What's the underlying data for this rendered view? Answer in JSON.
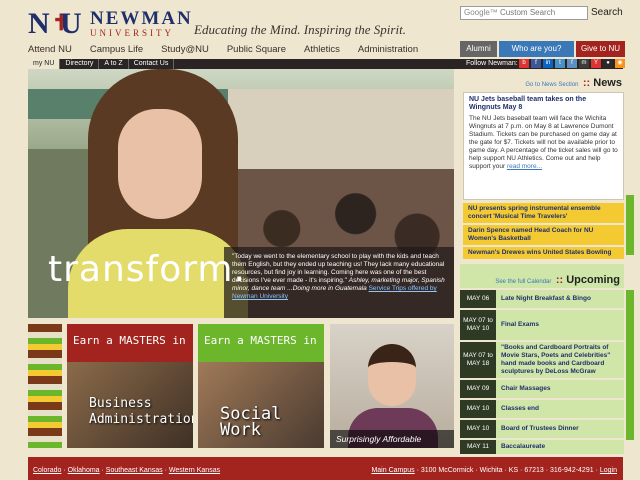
{
  "header": {
    "logo_name": "NEWMAN",
    "logo_university": "UNIVERSITY",
    "tagline": "Educating the Mind. Inspiring the Spirit.",
    "search_placeholder": "Custom Search",
    "search_button": "Search"
  },
  "nav": {
    "items": [
      "Attend NU",
      "Campus Life",
      "Study@NU",
      "Public Square",
      "Athletics",
      "Administration"
    ]
  },
  "tabs": {
    "alumni": "Alumni",
    "who": "Who are you?",
    "give": "Give to NU"
  },
  "subbar": {
    "items": [
      "my NU",
      "Directory",
      "A to Z",
      "Contact Us"
    ],
    "follow": "Follow Newman:"
  },
  "hero": {
    "headline": "transform.",
    "quote": "\"Today we went to the elementary school to play with the kids and teach them English, but they ended up teaching us! They lack many educational resources, but find joy in learning. Coming here was one of the best decisions I've ever made - it's inspiring.\"",
    "attribution": "Ashley, marketing major, Spanish minor, dance team ...Doing more in Guatemala",
    "link": "Service Trips offered by Newman University"
  },
  "news": {
    "go_link": "Go to News Section",
    "title": "News",
    "feature_headline": "NU Jets baseball team takes on the Wingnuts May 8",
    "feature_body": "The NU Jets baseball team will face the Wichita Wingnuts at 7 p.m. on May 8 at Lawrence Dumont Stadium. Tickets can be purchased on game day at the gate for $7. Tickets will not be available prior to game day. A percentage of the ticket sales will go to help support NU Athletics. Come out and help support your",
    "read_more": "read more...",
    "items": [
      "NU presents spring instrumental ensemble concert 'Musical Time Travelers'",
      "Darin Spence named Head Coach for NU Women's Basketball",
      "Newman's Drewes wins United States Bowling"
    ]
  },
  "upcoming": {
    "link": "See the full Calendar",
    "title": "Upcoming",
    "events": [
      {
        "date": "MAY 06",
        "title": "Late Night Breakfast & Bingo"
      },
      {
        "date": "MAY 07 to MAY 10",
        "title": "Final Exams"
      },
      {
        "date": "MAY 07 to MAY 18",
        "title": "\"Books and Cardboard Portraits of Movie Stars, Poets and Celebrities\" hand made books and Cardboard sculptures by DeLoss McGraw"
      },
      {
        "date": "MAY 09",
        "title": "Chair Massages"
      },
      {
        "date": "MAY 10",
        "title": "Classes end"
      },
      {
        "date": "MAY 10",
        "title": "Board of Trustees Dinner"
      },
      {
        "date": "MAY 11",
        "title": "Baccalaureate"
      }
    ]
  },
  "promos": {
    "biz_banner": "Earn a MASTERS in",
    "biz_label_1": "Business",
    "biz_label_2": "Administration",
    "sw_banner": "Earn a MASTERS in",
    "sw_label": "Social Work",
    "afford_caption": "Surprisingly Affordable"
  },
  "footer": {
    "locations": [
      "Colorado",
      "Oklahoma",
      "Southeast Kansas",
      "Western Kansas"
    ],
    "main_campus": "Main Campus",
    "address": "3100 McCormick · Wichita · KS · 67213 · 316-942-4291",
    "login": "Login"
  },
  "colors": {
    "brand_navy": "#1f2f6b",
    "brand_red": "#a3231f",
    "accent_green": "#6cb62b",
    "accent_yellow": "#f4ca33",
    "tab_blue": "#3a78b7"
  }
}
